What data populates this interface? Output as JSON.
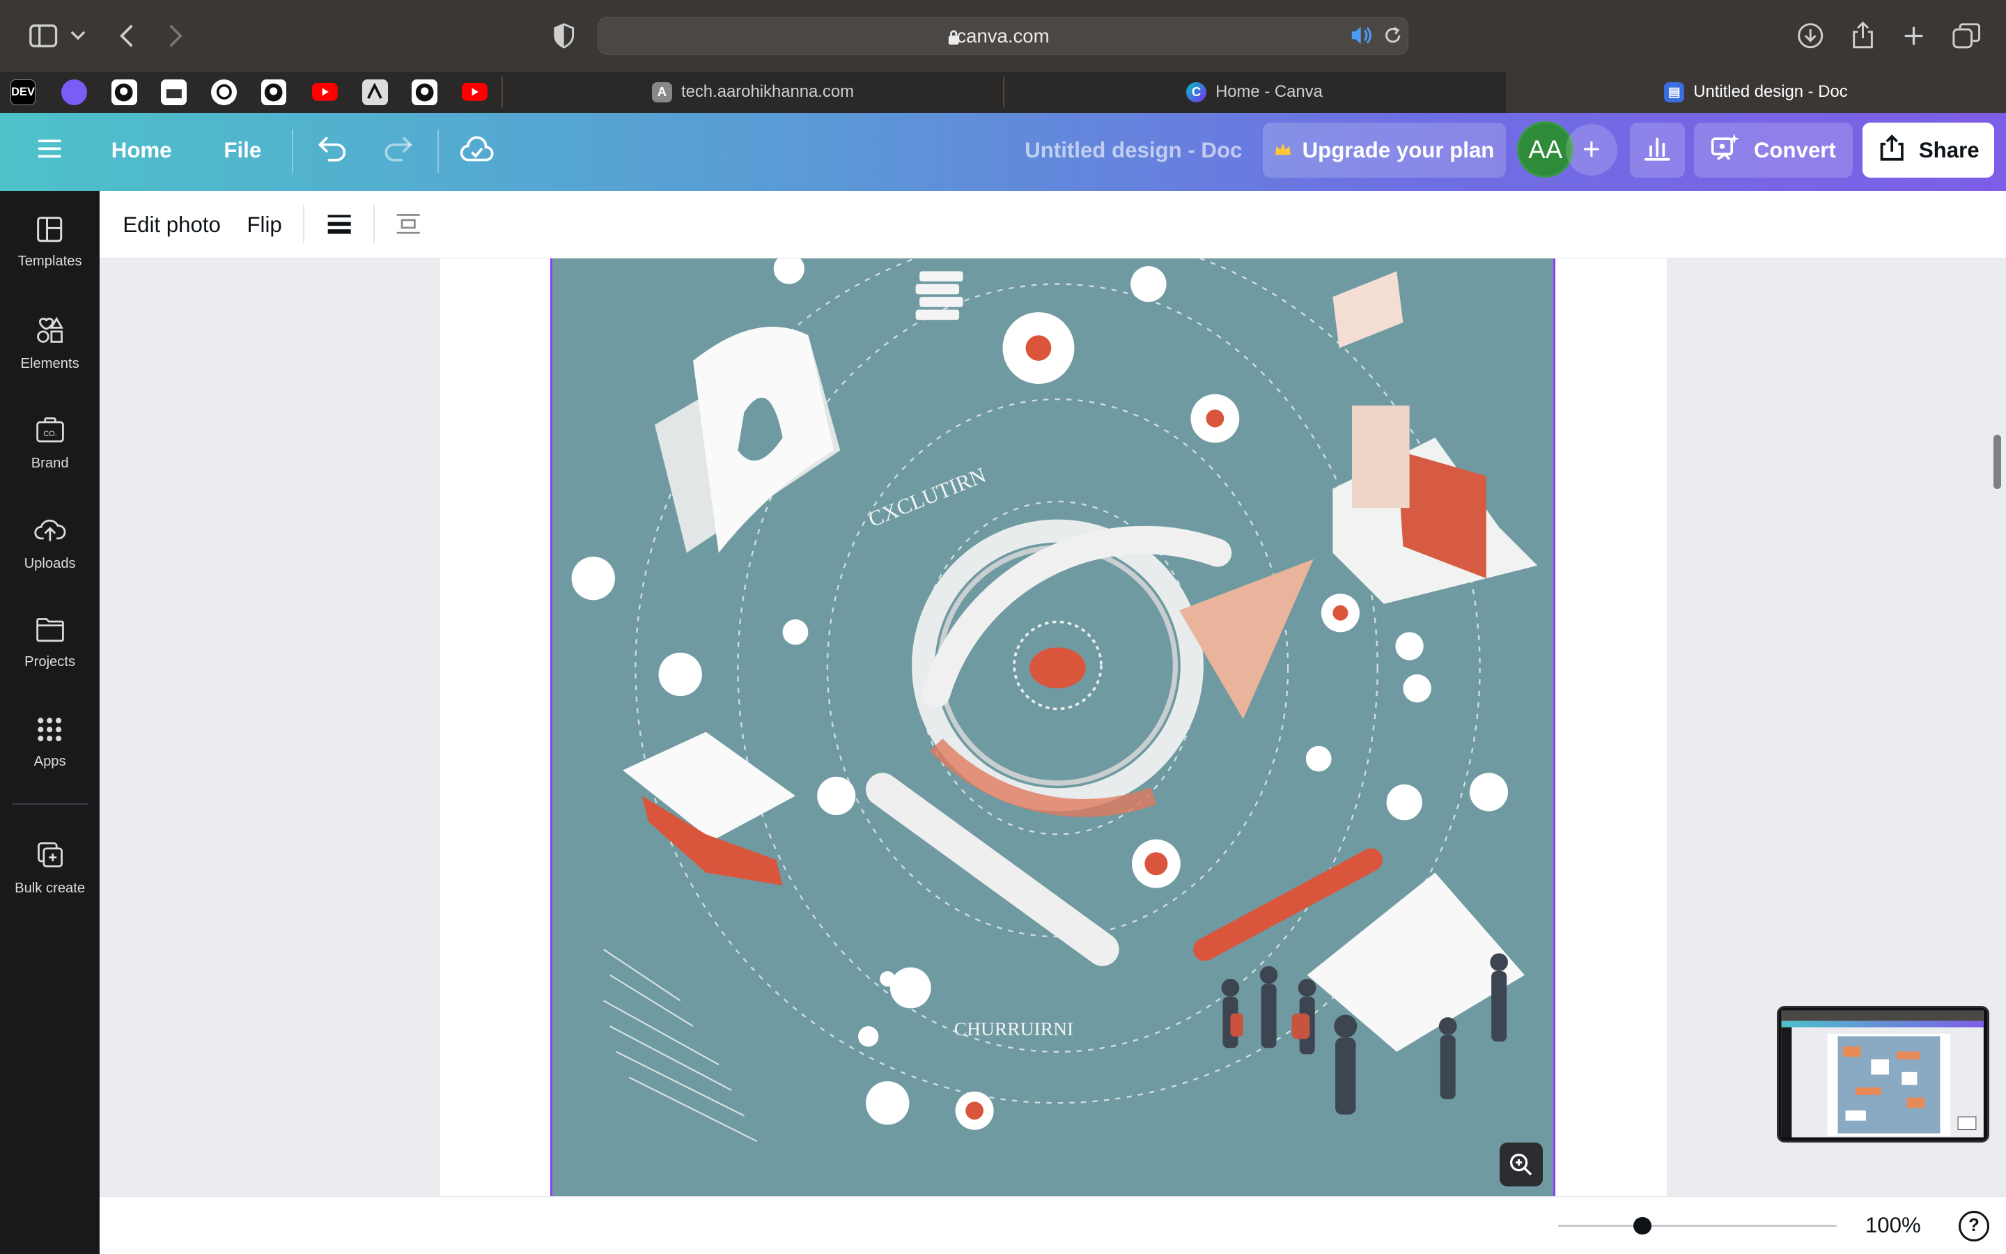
{
  "browser": {
    "url": "canva.com",
    "tabs": [
      {
        "label": "tech.aarohikhanna.com",
        "icon": "A"
      },
      {
        "label": "Home - Canva",
        "icon": "C"
      },
      {
        "label": "Untitled design - Doc",
        "icon": "▤"
      }
    ],
    "favorites": [
      "DEV",
      "PH",
      "GH",
      "DOC",
      "AI",
      "GH",
      "YT",
      "N",
      "GH",
      "YT"
    ]
  },
  "header": {
    "home_label": "Home",
    "file_label": "File",
    "doc_title": "Untitled design - Doc",
    "upgrade_label": "Upgrade your plan",
    "avatar_initials": "AA",
    "convert_label": "Convert",
    "share_label": "Share"
  },
  "sidebar": {
    "items": [
      {
        "label": "Templates"
      },
      {
        "label": "Elements"
      },
      {
        "label": "Brand"
      },
      {
        "label": "Uploads"
      },
      {
        "label": "Projects"
      },
      {
        "label": "Apps"
      },
      {
        "label": "Bulk create"
      }
    ]
  },
  "toolbar": {
    "edit_photo_label": "Edit photo",
    "flip_label": "Flip"
  },
  "canvas": {
    "image_text_1": "CXCLUTIRN",
    "image_text_2": "CHURRUIRNI"
  },
  "footer": {
    "zoom_text": "100%",
    "help_label": "?",
    "zoom_level": 0.27
  },
  "colors": {
    "accent": "#8b3dff",
    "header_gradient_start": "#4dc2c9",
    "header_gradient_end": "#7d5ee6",
    "image_bg": "#6f9aa1",
    "avatar_bg": "#2e8b3a"
  }
}
